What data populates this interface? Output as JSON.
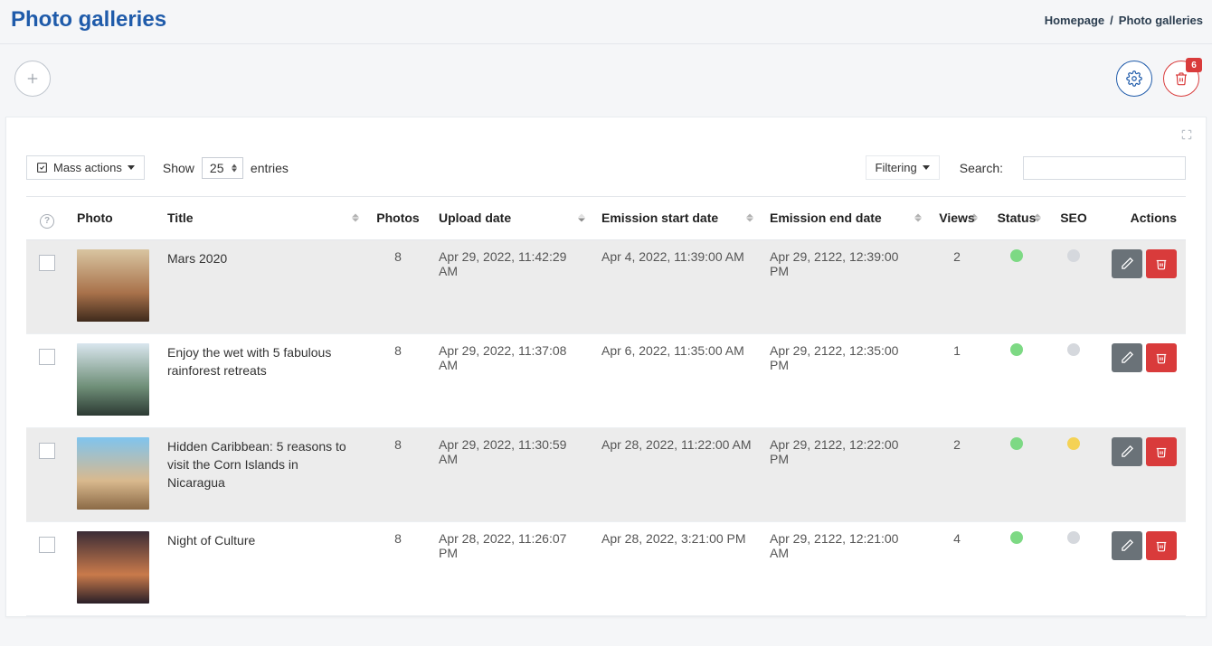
{
  "page_title": "Photo galleries",
  "breadcrumbs": {
    "home": "Homepage",
    "current": "Photo galleries"
  },
  "trash_badge": "6",
  "controls": {
    "mass_actions_label": "Mass actions",
    "show_label": "Show",
    "entries_label": "entries",
    "page_size_value": "25",
    "filtering_label": "Filtering",
    "search_label": "Search:"
  },
  "columns": {
    "photo": "Photo",
    "title": "Title",
    "photos": "Photos",
    "upload": "Upload date",
    "start": "Emission start date",
    "end": "Emission end date",
    "views": "Views",
    "status": "Status",
    "seo": "SEO",
    "actions": "Actions"
  },
  "rows": [
    {
      "title": "Mars 2020",
      "photos": "8",
      "upload": "Apr 29, 2022, 11:42:29 AM",
      "start": "Apr 4, 2022, 11:39:00 AM",
      "end": "Apr 29, 2122, 12:39:00 PM",
      "views": "2",
      "status": "green",
      "seo": "gray",
      "thumb": "th-1"
    },
    {
      "title": "Enjoy the wet with 5 fabulous rainforest retreats",
      "photos": "8",
      "upload": "Apr 29, 2022, 11:37:08 AM",
      "start": "Apr 6, 2022, 11:35:00 AM",
      "end": "Apr 29, 2122, 12:35:00 PM",
      "views": "1",
      "status": "green",
      "seo": "gray",
      "thumb": "th-2"
    },
    {
      "title": "Hidden Caribbean: 5 reasons to visit the Corn Islands in Nicaragua",
      "photos": "8",
      "upload": "Apr 29, 2022, 11:30:59 AM",
      "start": "Apr 28, 2022, 11:22:00 AM",
      "end": "Apr 29, 2122, 12:22:00 PM",
      "views": "2",
      "status": "green",
      "seo": "yellow",
      "thumb": "th-3"
    },
    {
      "title": "Night of Culture",
      "photos": "8",
      "upload": "Apr 28, 2022, 11:26:07 PM",
      "start": "Apr 28, 2022, 3:21:00 PM",
      "end": "Apr 29, 2122, 12:21:00 AM",
      "views": "4",
      "status": "green",
      "seo": "gray",
      "thumb": "th-4"
    }
  ]
}
